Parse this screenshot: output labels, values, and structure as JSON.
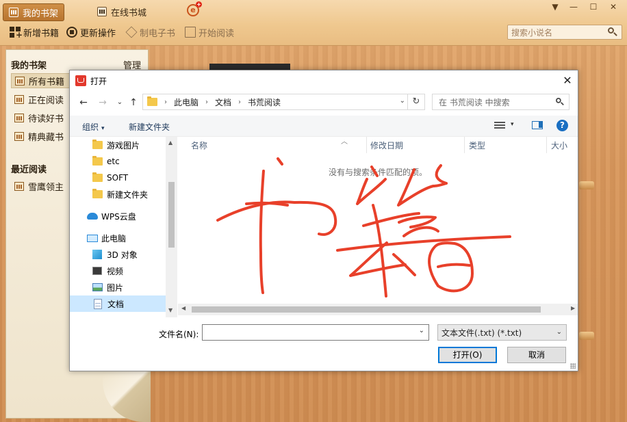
{
  "app": {
    "tabs": [
      {
        "label": "我的书架",
        "active": true
      },
      {
        "label": "在线书城",
        "active": false
      }
    ],
    "window_controls": [
      "▼",
      "—",
      "☐",
      "✕"
    ],
    "toolbar": [
      {
        "label": "新增书籍",
        "icon": "add-books-icon",
        "enabled": true
      },
      {
        "label": "更新操作",
        "icon": "update-icon",
        "enabled": true
      },
      {
        "label": "制电子书",
        "icon": "cube-icon",
        "enabled": false
      },
      {
        "label": "开始阅读",
        "icon": "book-icon",
        "enabled": false
      }
    ],
    "search_placeholder": "搜索小说名"
  },
  "sidebar": {
    "shelf_heading": "我的书架",
    "manage_label": "管理",
    "items": [
      {
        "label": "所有书籍",
        "selected": true
      },
      {
        "label": "正在阅读",
        "selected": false
      },
      {
        "label": "待读好书",
        "selected": false
      },
      {
        "label": "精典藏书",
        "selected": false
      }
    ],
    "recent_heading": "最近阅读",
    "recent_items": [
      {
        "label": "雪鹰领主"
      }
    ]
  },
  "dialog": {
    "title": "打开",
    "close_glyph": "✕",
    "nav": {
      "back": "←",
      "forward": "→",
      "history": "⌄",
      "up": "↑"
    },
    "address": {
      "segments": [
        "此电脑",
        "文档",
        "书荒阅读"
      ],
      "separator": "›",
      "dropdown": "⌄",
      "refresh": "↻"
    },
    "search_placeholder": "在 书荒阅读 中搜索",
    "commands": {
      "organize": "组织",
      "organize_caret": "▾",
      "new_folder": "新建文件夹",
      "view_caret": "▾",
      "help": "?"
    },
    "nav_items": [
      {
        "label": "游戏图片",
        "icon": "folder-icon",
        "pinned": true
      },
      {
        "label": "etc",
        "icon": "folder-icon",
        "pinned": true
      },
      {
        "label": "SOFT",
        "icon": "folder-icon",
        "pinned": false
      },
      {
        "label": "新建文件夹",
        "icon": "folder-icon",
        "pinned": false
      },
      {
        "label": "WPS云盘",
        "icon": "cloud-icon",
        "pinned": false
      },
      {
        "label": "此电脑",
        "icon": "computer-icon",
        "pinned": false
      },
      {
        "label": "3D 对象",
        "icon": "cube-3d-icon",
        "pinned": false
      },
      {
        "label": "视频",
        "icon": "video-icon",
        "pinned": false
      },
      {
        "label": "图片",
        "icon": "pictures-icon",
        "pinned": false
      },
      {
        "label": "文档",
        "icon": "documents-icon",
        "pinned": false,
        "selected": true
      }
    ],
    "pin_glyph": "📌",
    "scroll_glyphs": {
      "up": "▲",
      "down": "▼",
      "left": "◀",
      "right": "▶"
    },
    "columns": [
      "名称",
      "修改日期",
      "类型",
      "大小"
    ],
    "sort_glyph": "︿",
    "empty_message": "没有与搜索条件匹配的项。",
    "filename_label": "文件名(N):",
    "filename_value": "",
    "filename_dropdown": "⌄",
    "filetype_value": "文本文件(.txt) (*.txt)",
    "filetype_dropdown": "⌄",
    "open_button": "打开(O)",
    "cancel_button": "取消"
  },
  "annotation": {
    "handwriting": "书籍",
    "color": "#e8402a"
  },
  "colors": {
    "wood": "#d8985e",
    "active_tab": "#b8742f",
    "selection_blue": "#cce8ff",
    "primary_border": "#0078d7"
  }
}
